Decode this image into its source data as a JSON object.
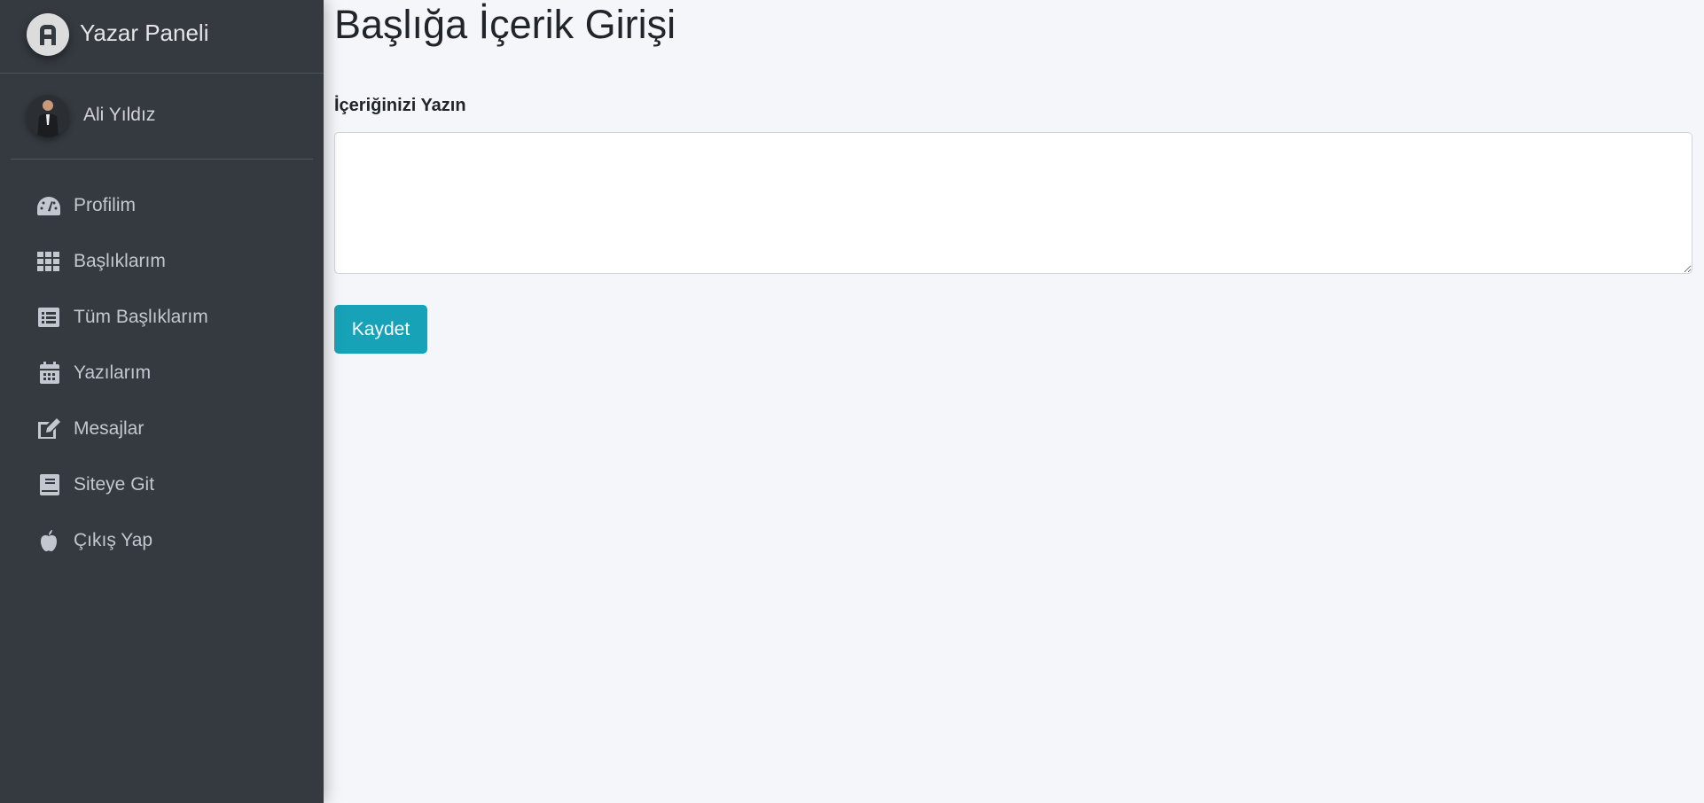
{
  "brand": {
    "title": "Yazar Paneli"
  },
  "user": {
    "name": "Ali Yıldız"
  },
  "sidebar": {
    "items": [
      {
        "label": "Profilim",
        "icon": "tachometer-icon"
      },
      {
        "label": "Başlıklarım",
        "icon": "grid-icon"
      },
      {
        "label": "Tüm Başlıklarım",
        "icon": "list-alt-icon"
      },
      {
        "label": "Yazılarım",
        "icon": "calendar-icon"
      },
      {
        "label": "Mesajlar",
        "icon": "edit-icon"
      },
      {
        "label": "Siteye Git",
        "icon": "book-icon"
      },
      {
        "label": "Çıkış Yap",
        "icon": "apple-icon"
      }
    ]
  },
  "main": {
    "title": "Başlığa İçerik Girişi",
    "content_label": "İçeriğinizi Yazın",
    "content_value": "",
    "save_label": "Kaydet"
  },
  "colors": {
    "sidebar": "#343a40",
    "accent": "#17a2b8",
    "background": "#f4f6f9"
  }
}
